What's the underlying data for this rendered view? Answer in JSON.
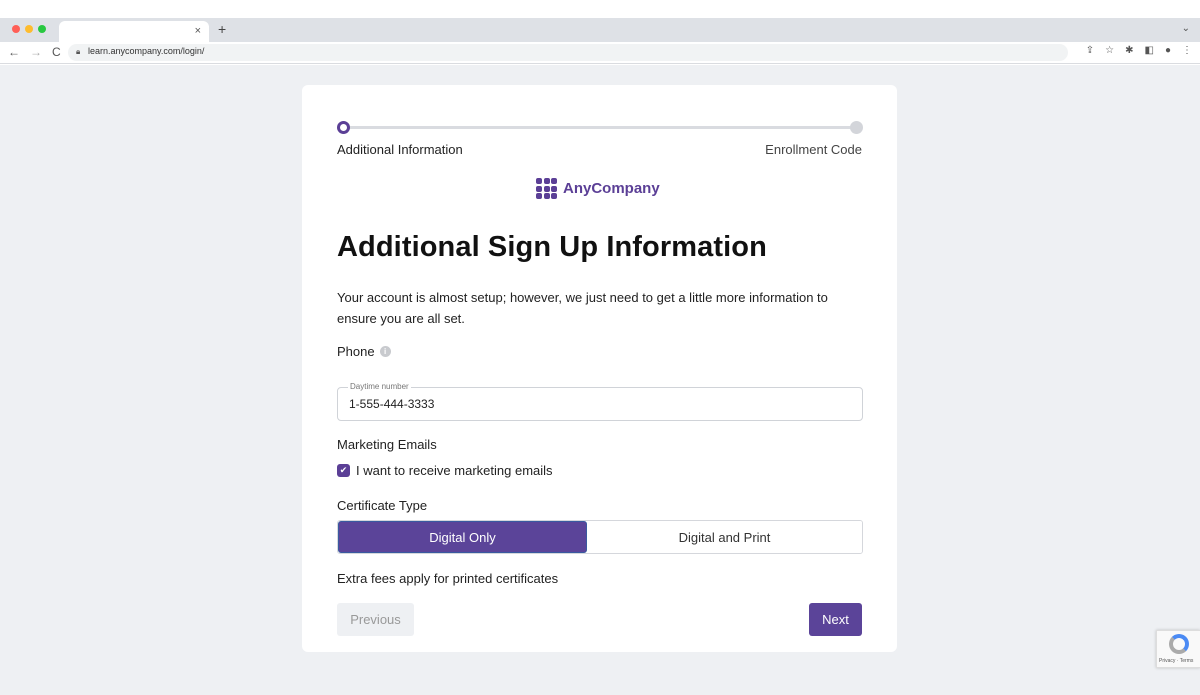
{
  "browser": {
    "tab_title": "",
    "tab_close": "×",
    "new_tab": "+",
    "tab_menu": "⌄",
    "url": "learn.anycompany.com/login/",
    "nav": {
      "back": "←",
      "forward": "→",
      "reload": "C"
    },
    "toolbar_icons": [
      "share-icon",
      "star-icon",
      "extensions-icon",
      "sidepanel-icon",
      "profile-icon",
      "menu-icon"
    ]
  },
  "stepper": {
    "steps": [
      {
        "label": "Additional Information",
        "state": "current"
      },
      {
        "label": "Enrollment Code",
        "state": "upcoming"
      }
    ],
    "progress": 0
  },
  "brand": {
    "name": "AnyCompany",
    "color": "#5b3f96"
  },
  "form": {
    "title": "Additional Sign Up Information",
    "intro": "Your account is almost setup; however, we just need to get a little more information to ensure you are all set.",
    "phone": {
      "label": "Phone",
      "legend": "Daytime number",
      "value": "1-555-444-3333"
    },
    "marketing": {
      "label": "Marketing Emails",
      "checkbox_label": "I want to receive marketing emails",
      "checked": true
    },
    "certificate": {
      "label": "Certificate Type",
      "options": [
        "Digital Only",
        "Digital and Print"
      ],
      "selected": "Digital Only",
      "note": "Extra fees apply for printed certificates"
    },
    "buttons": {
      "previous": "Previous",
      "next": "Next"
    }
  },
  "recaptcha": {
    "text": "Privacy · Terms"
  },
  "colors": {
    "accent": "#5b4499",
    "page_bg": "#eef0f3"
  }
}
